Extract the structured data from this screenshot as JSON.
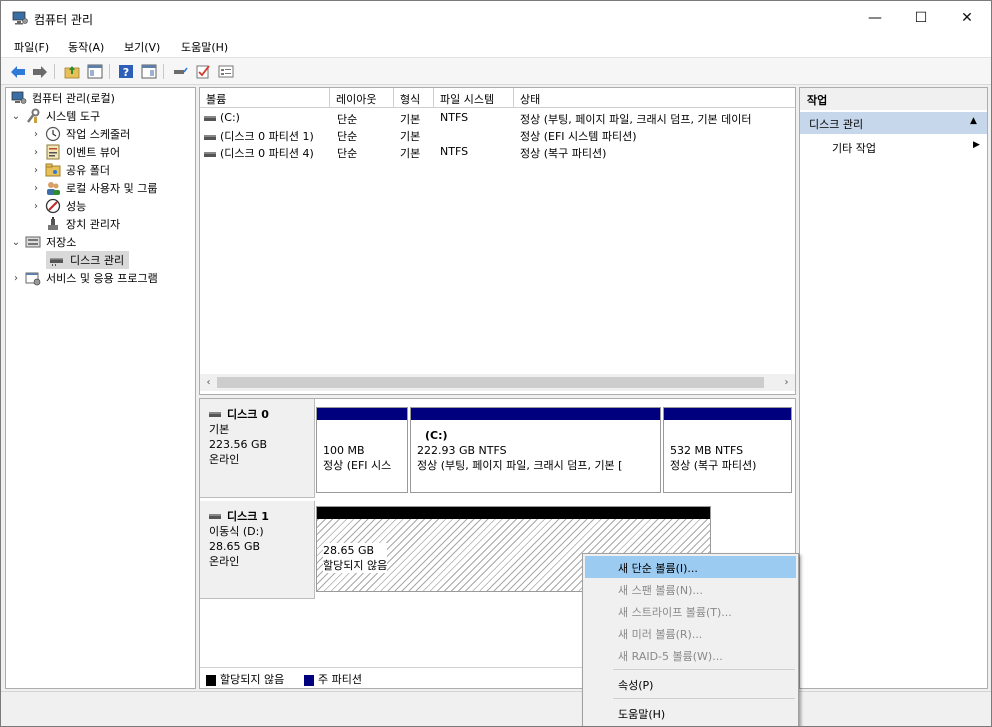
{
  "window": {
    "title": "컴퓨터 관리",
    "minimize_glyph": "—",
    "maximize_glyph": "☐",
    "close_glyph": "✕"
  },
  "menu": [
    "파일(F)",
    "동작(A)",
    "보기(V)",
    "도움말(H)"
  ],
  "toolbar": {
    "icons": [
      "back-arrow-icon",
      "forward-arrow-icon",
      "up-folder-icon",
      "show-hide-console-tree-icon",
      "help-icon",
      "show-hide-action-pane-icon",
      "connect-drive-icon",
      "checklist-icon",
      "properties-list-icon"
    ]
  },
  "tree": {
    "items": [
      {
        "label": "컴퓨터 관리(로컬)",
        "indent": 0,
        "chevron": "",
        "icon": "computer-management-icon"
      },
      {
        "label": "시스템 도구",
        "indent": 1,
        "chevron": "⌄",
        "icon": "system-tools-icon"
      },
      {
        "label": "작업 스케줄러",
        "indent": 2,
        "chevron": "›",
        "icon": "task-scheduler-icon"
      },
      {
        "label": "이벤트 뷰어",
        "indent": 2,
        "chevron": "›",
        "icon": "event-viewer-icon"
      },
      {
        "label": "공유 폴더",
        "indent": 2,
        "chevron": "›",
        "icon": "shared-folder-icon"
      },
      {
        "label": "로컬 사용자 및 그룹",
        "indent": 2,
        "chevron": "›",
        "icon": "local-users-icon"
      },
      {
        "label": "성능",
        "indent": 2,
        "chevron": "›",
        "icon": "performance-icon"
      },
      {
        "label": "장치 관리자",
        "indent": 2,
        "chevron": "",
        "icon": "device-manager-icon"
      },
      {
        "label": "저장소",
        "indent": 1,
        "chevron": "⌄",
        "icon": "storage-icon"
      },
      {
        "label": "디스크 관리",
        "indent": 2,
        "chevron": "",
        "icon": "disk-management-icon",
        "selected": true
      },
      {
        "label": "서비스 및 응용 프로그램",
        "indent": 1,
        "chevron": "›",
        "icon": "services-icon"
      }
    ]
  },
  "volumes": {
    "columns": [
      "볼륨",
      "레이아웃",
      "형식",
      "파일 시스템",
      "상태"
    ],
    "rows": [
      [
        "(C:)",
        "단순",
        "기본",
        "NTFS",
        "정상 (부팅, 페이지 파일, 크래시 덤프, 기본 데이터"
      ],
      [
        "(디스크 0 파티션 1)",
        "단순",
        "기본",
        "",
        "정상 (EFI 시스템 파티션)"
      ],
      [
        "(디스크 0 파티션 4)",
        "단순",
        "기본",
        "NTFS",
        "정상 (복구 파티션)"
      ]
    ],
    "scroll_left": "‹",
    "scroll_right": "›"
  },
  "disks": [
    {
      "name": "디스크 0",
      "type": "기본",
      "size": "223.56 GB",
      "status": "온라인",
      "partitions": [
        {
          "title": "",
          "line1": "100 MB",
          "line2": "정상 (EFI 시스"
        },
        {
          "title": "(C:)",
          "line1": "222.93 GB NTFS",
          "line2": "정상 (부팅, 페이지 파일, 크래시 덤프, 기본 [ "
        },
        {
          "title": "",
          "line1": "532 MB NTFS",
          "line2": "정상 (복구 파티션)"
        }
      ]
    },
    {
      "name": "디스크 1",
      "type": "이동식 (D:)",
      "size": "28.65 GB",
      "status": "온라인",
      "partitions": [
        {
          "title": "",
          "line1": "28.65 GB",
          "line2": "할당되지 않음"
        }
      ]
    }
  ],
  "legend": [
    {
      "label": "할당되지 않음",
      "color": "#000000"
    },
    {
      "label": "주 파티션",
      "color": "#00007f"
    }
  ],
  "actions": {
    "header": "작업",
    "section": "디스크 관리",
    "section_arrow": "▲",
    "item": "기타 작업",
    "item_arrow": "▶"
  },
  "context_menu": {
    "items": [
      {
        "label": "새 단순 볼륨(I)...",
        "enabled": true,
        "highlight": true
      },
      {
        "label": "새 스팬 볼륨(N)...",
        "enabled": false
      },
      {
        "label": "새 스트라이프 볼륨(T)...",
        "enabled": false
      },
      {
        "label": "새 미러 볼륨(R)...",
        "enabled": false
      },
      {
        "label": "새 RAID-5 볼륨(W)...",
        "enabled": false
      },
      {
        "label": "속성(P)",
        "enabled": true
      },
      {
        "label": "도움말(H)",
        "enabled": true
      }
    ]
  },
  "colors": {
    "primary_partition": "#00007f",
    "unallocated": "#000000",
    "action_section_bg": "#c6d7ec",
    "menu_highlight": "#9ccbf2"
  }
}
